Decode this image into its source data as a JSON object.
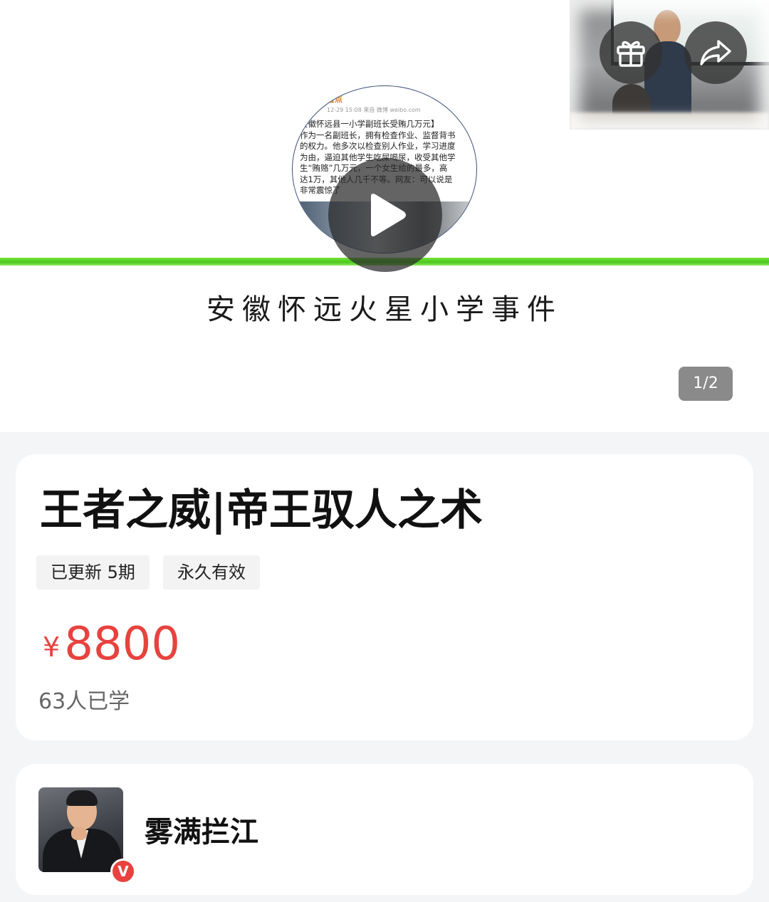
{
  "banner": {
    "caption": "安徽怀远火星小学事件",
    "pager": "1/2",
    "clip": {
      "source": "看点",
      "meta": "12-29 15:08  来自 微博 weibo.com",
      "lines": [
        "安徽怀远县一小学副班长受贿几万元】",
        "作为一名副班长，拥有检查作业、监督背书",
        "的权力。他多次以检查别人作业，学习进度",
        "为由，逼迫其他学生吃屎喝尿，收受其他学",
        "生“贿赂”几万元，一个女生给的最多，高",
        "达1万，其他人几千不等。网友：可以说是",
        "非常震惊了"
      ]
    }
  },
  "actions": {
    "gift_icon": "gift-icon",
    "share_icon": "share-icon",
    "play_icon": "play-icon"
  },
  "course": {
    "title": "王者之威|帝王驭人之术",
    "tags": [
      "已更新 5期",
      "永久有效"
    ],
    "price_symbol": "¥",
    "price": "8800",
    "learners": "63人已学"
  },
  "author": {
    "name": "雾满拦江",
    "badge": "V"
  },
  "colors": {
    "price": "#e8423e",
    "accent_line": "#49c71d",
    "card_bg": "#ffffff",
    "page_bg": "#f4f5f7"
  }
}
